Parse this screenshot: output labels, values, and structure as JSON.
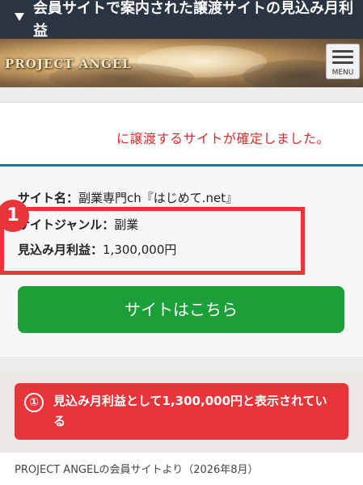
{
  "header": {
    "title": "会員サイトで案内された譲渡サイトの見込み月利益"
  },
  "banner": {
    "logo_text": "PROJECT ANGEL",
    "menu_label": "MENU"
  },
  "card": {
    "confirm_text": "に譲渡するサイトが確定しました。",
    "site_name_label": "サイト名：",
    "site_name_value": "副業専門ch『はじめて.net』",
    "genre_label": "サイトジャンル：",
    "genre_value": "副業",
    "profit_label": "見込み月利益：",
    "profit_value": "1,300,000円",
    "badge_number": "1",
    "button_label": "サイトはこちら"
  },
  "callout": {
    "number": "①",
    "text": "見込み月利益として1,300,000円と表示されている"
  },
  "footer": {
    "source": "PROJECT ANGELの会員サイトより（2026年8月）"
  },
  "colors": {
    "accent_red": "#e8353a",
    "button_green": "#1ba039",
    "title_bar": "#2b3542",
    "divider_blue": "#1f6fb1"
  }
}
